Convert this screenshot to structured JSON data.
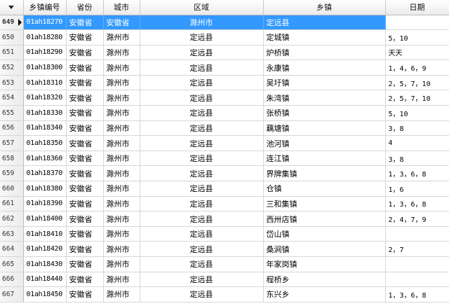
{
  "columns": {
    "rownum": "",
    "code": "乡镇编号",
    "province": "省份",
    "city": "城市",
    "area": "区域",
    "town": "乡镇",
    "date": "日期"
  },
  "colors": {
    "selection": "#3399ff",
    "header_bg": "#ebebeb",
    "grid_line": "#d6d6d6"
  },
  "rows": [
    {
      "num": "649",
      "code": "01ah18270",
      "province": "安徽省",
      "city": "安徽省",
      "area": "滁州市",
      "town": "定远县",
      "date": "",
      "selected": true
    },
    {
      "num": "650",
      "code": "01ah18280",
      "province": "安徽省",
      "city": "滁州市",
      "area": "定远县",
      "town": "定城镇",
      "date": "5，10"
    },
    {
      "num": "651",
      "code": "01ah18290",
      "province": "安徽省",
      "city": "滁州市",
      "area": "定远县",
      "town": "炉桥镇",
      "date": "天天"
    },
    {
      "num": "652",
      "code": "01ah18300",
      "province": "安徽省",
      "city": "滁州市",
      "area": "定远县",
      "town": "永康镇",
      "date": "1，4，6，9"
    },
    {
      "num": "653",
      "code": "01ah18310",
      "province": "安徽省",
      "city": "滁州市",
      "area": "定远县",
      "town": "吴圩镇",
      "date": "2，5，7，10"
    },
    {
      "num": "654",
      "code": "01ah18320",
      "province": "安徽省",
      "city": "滁州市",
      "area": "定远县",
      "town": "朱湾镇",
      "date": "2，5，7，10"
    },
    {
      "num": "655",
      "code": "01ah18330",
      "province": "安徽省",
      "city": "滁州市",
      "area": "定远县",
      "town": "张桥镇",
      "date": "5，10"
    },
    {
      "num": "656",
      "code": "01ah18340",
      "province": "安徽省",
      "city": "滁州市",
      "area": "定远县",
      "town": "藕塘镇",
      "date": "3，8"
    },
    {
      "num": "657",
      "code": "01ah18350",
      "province": "安徽省",
      "city": "滁州市",
      "area": "定远县",
      "town": "池河镇",
      "date": "4"
    },
    {
      "num": "658",
      "code": "01ah18360",
      "province": "安徽省",
      "city": "滁州市",
      "area": "定远县",
      "town": "连江镇",
      "date": "3，8"
    },
    {
      "num": "659",
      "code": "01ah18370",
      "province": "安徽省",
      "city": "滁州市",
      "area": "定远县",
      "town": "界牌集镇",
      "date": "1，3，6，8"
    },
    {
      "num": "660",
      "code": "01ah18380",
      "province": "安徽省",
      "city": "滁州市",
      "area": "定远县",
      "town": "仓镇",
      "date": "1，6"
    },
    {
      "num": "661",
      "code": "01ah18390",
      "province": "安徽省",
      "city": "滁州市",
      "area": "定远县",
      "town": "三和集镇",
      "date": "1，3，6，8"
    },
    {
      "num": "662",
      "code": "01ah18400",
      "province": "安徽省",
      "city": "滁州市",
      "area": "定远县",
      "town": "西卅店镇",
      "date": "2，4，7，9"
    },
    {
      "num": "663",
      "code": "01ah18410",
      "province": "安徽省",
      "city": "滁州市",
      "area": "定远县",
      "town": "岱山镇",
      "date": ""
    },
    {
      "num": "664",
      "code": "01ah18420",
      "province": "安徽省",
      "city": "滁州市",
      "area": "定远县",
      "town": "桑涧镇",
      "date": "2，7"
    },
    {
      "num": "665",
      "code": "01ah18430",
      "province": "安徽省",
      "city": "滁州市",
      "area": "定远县",
      "town": "年家岗镇",
      "date": ""
    },
    {
      "num": "666",
      "code": "01ah18440",
      "province": "安徽省",
      "city": "滁州市",
      "area": "定远县",
      "town": "程桥乡",
      "date": ""
    },
    {
      "num": "667",
      "code": "01ah18450",
      "province": "安徽省",
      "city": "滁州市",
      "area": "定远县",
      "town": "东兴乡",
      "date": "1，3，6，8"
    }
  ]
}
